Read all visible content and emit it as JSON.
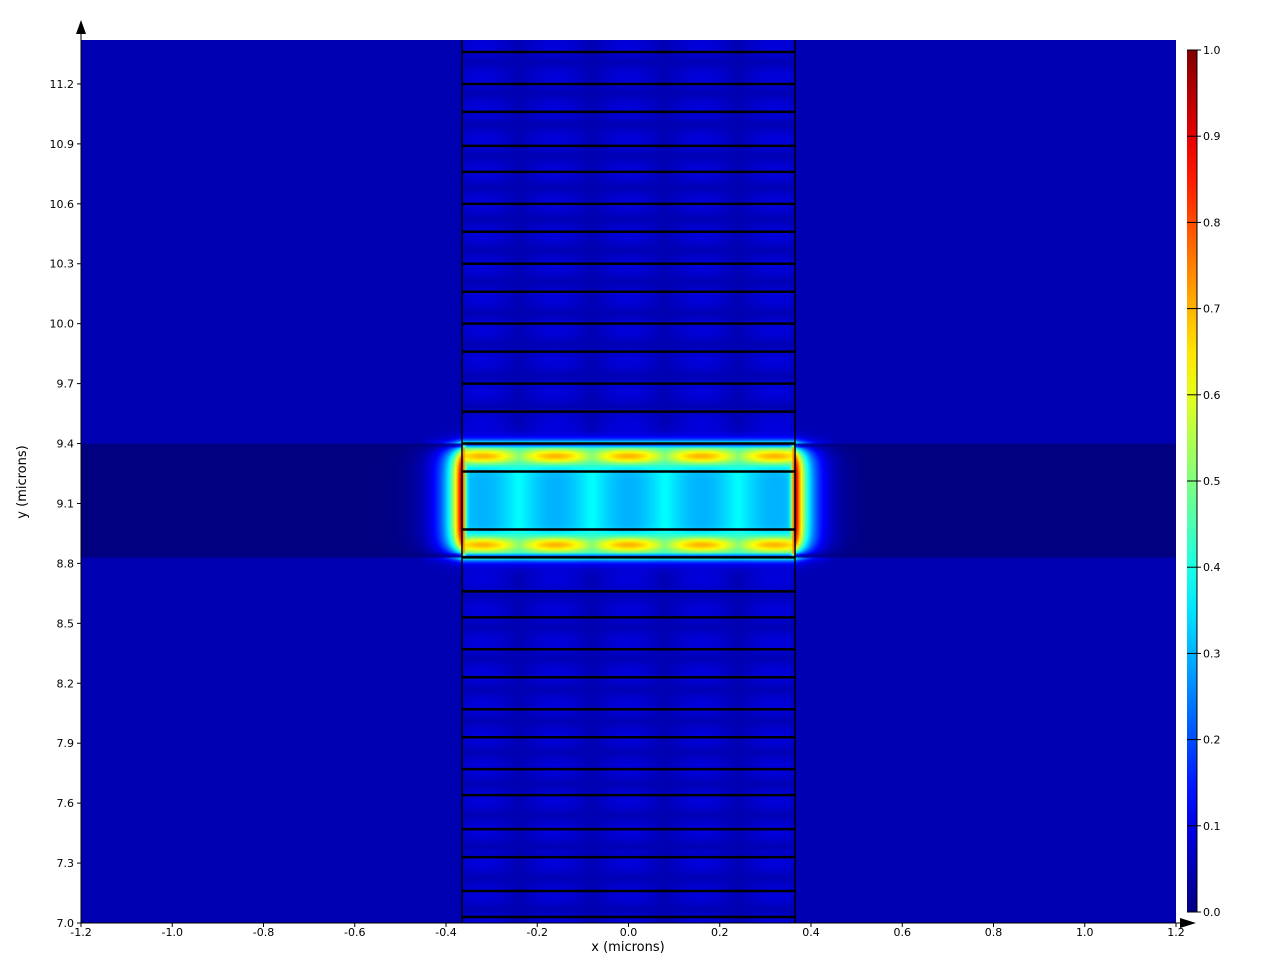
{
  "chart_data": {
    "type": "heatmap",
    "title": "",
    "xlabel": "x (microns)",
    "ylabel": "y (microns)",
    "xlim": [
      -1.2,
      1.2
    ],
    "ylim": [
      7.0,
      11.42
    ],
    "x_ticks": [
      "-1.2",
      "-1.0",
      "-0.8",
      "-0.6",
      "-0.4",
      "-0.2",
      "0.0",
      "0.2",
      "0.4",
      "0.6",
      "0.8",
      "1.0",
      "1.2"
    ],
    "y_ticks": [
      "7.0",
      "7.3",
      "7.6",
      "7.9",
      "8.2",
      "8.5",
      "8.8",
      "9.1",
      "9.4",
      "9.7",
      "10.0",
      "10.3",
      "10.6",
      "10.9",
      "11.2"
    ],
    "colorbar": {
      "range": [
        0.0,
        1.0
      ],
      "ticks": [
        "0.0",
        "0.1",
        "0.2",
        "0.3",
        "0.4",
        "0.5",
        "0.6",
        "0.7",
        "0.8",
        "0.9",
        "1.0"
      ],
      "colormap": "jet"
    },
    "structure": {
      "waveguide_x": [
        -0.365,
        0.365
      ],
      "layer_boundaries_y": [
        7.03,
        7.16,
        7.33,
        7.47,
        7.64,
        7.77,
        7.93,
        8.07,
        8.23,
        8.37,
        8.53,
        8.66,
        8.83,
        8.97,
        9.26,
        9.4,
        9.56,
        9.7,
        9.86,
        10.0,
        10.16,
        10.3,
        10.46,
        10.6,
        10.76,
        10.89,
        11.06,
        11.2,
        11.36
      ],
      "core_y": [
        8.83,
        9.4
      ]
    },
    "field_peaks": {
      "edge_peak_value": 1.0,
      "core_max_value": 0.7,
      "core_min_value": 0.38,
      "cladding_value": 0.05
    }
  }
}
